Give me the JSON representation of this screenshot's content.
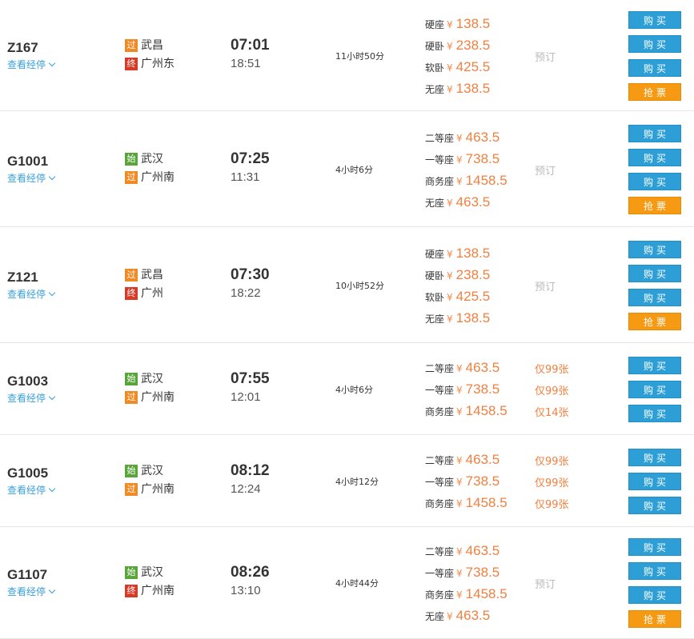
{
  "labels": {
    "via": "查看经停",
    "buy": "购买",
    "grab": "抢票",
    "book": "预订",
    "yen": "¥"
  },
  "colors": {
    "buy": "#2d9fd6",
    "grab": "#f59a12",
    "price": "#f08040",
    "link": "#3aa0d8",
    "badge_guo": "#f08a24",
    "badge_zhong": "#d83a28",
    "badge_shi": "#5aa53a"
  },
  "trains": [
    {
      "no": "Z167",
      "from": {
        "badge": "过",
        "name": "武昌"
      },
      "to": {
        "badge": "终",
        "name": "广州东"
      },
      "depart": "07:01",
      "arrive": "18:51",
      "duration": "11小时50分",
      "seats": [
        {
          "name": "硬座",
          "price": "138.5"
        },
        {
          "name": "硬卧",
          "price": "238.5"
        },
        {
          "name": "软卧",
          "price": "425.5"
        },
        {
          "name": "无座",
          "price": "138.5"
        }
      ],
      "stock": [],
      "buttons": [
        "buy",
        "buy",
        "buy",
        "grab"
      ]
    },
    {
      "no": "G1001",
      "from": {
        "badge": "始",
        "name": "武汉"
      },
      "to": {
        "badge": "过",
        "name": "广州南"
      },
      "depart": "07:25",
      "arrive": "11:31",
      "duration": "4小时6分",
      "seats": [
        {
          "name": "二等座",
          "price": "463.5"
        },
        {
          "name": "一等座",
          "price": "738.5"
        },
        {
          "name": "商务座",
          "price": "1458.5"
        },
        {
          "name": "无座",
          "price": "463.5"
        }
      ],
      "stock": [],
      "buttons": [
        "buy",
        "buy",
        "buy",
        "grab"
      ]
    },
    {
      "no": "Z121",
      "from": {
        "badge": "过",
        "name": "武昌"
      },
      "to": {
        "badge": "终",
        "name": "广州"
      },
      "depart": "07:30",
      "arrive": "18:22",
      "duration": "10小时52分",
      "seats": [
        {
          "name": "硬座",
          "price": "138.5"
        },
        {
          "name": "硬卧",
          "price": "238.5"
        },
        {
          "name": "软卧",
          "price": "425.5"
        },
        {
          "name": "无座",
          "price": "138.5"
        }
      ],
      "stock": [],
      "buttons": [
        "buy",
        "buy",
        "buy",
        "grab"
      ]
    },
    {
      "no": "G1003",
      "from": {
        "badge": "始",
        "name": "武汉"
      },
      "to": {
        "badge": "过",
        "name": "广州南"
      },
      "depart": "07:55",
      "arrive": "12:01",
      "duration": "4小时6分",
      "seats": [
        {
          "name": "二等座",
          "price": "463.5"
        },
        {
          "name": "一等座",
          "price": "738.5"
        },
        {
          "name": "商务座",
          "price": "1458.5"
        }
      ],
      "stock": [
        "仅99张",
        "仅99张",
        "仅14张"
      ],
      "buttons": [
        "buy",
        "buy",
        "buy"
      ]
    },
    {
      "no": "G1005",
      "from": {
        "badge": "始",
        "name": "武汉"
      },
      "to": {
        "badge": "过",
        "name": "广州南"
      },
      "depart": "08:12",
      "arrive": "12:24",
      "duration": "4小时12分",
      "seats": [
        {
          "name": "二等座",
          "price": "463.5"
        },
        {
          "name": "一等座",
          "price": "738.5"
        },
        {
          "name": "商务座",
          "price": "1458.5"
        }
      ],
      "stock": [
        "仅99张",
        "仅99张",
        "仅99张"
      ],
      "buttons": [
        "buy",
        "buy",
        "buy"
      ]
    },
    {
      "no": "G1107",
      "from": {
        "badge": "始",
        "name": "武汉"
      },
      "to": {
        "badge": "终",
        "name": "广州南"
      },
      "depart": "08:26",
      "arrive": "13:10",
      "duration": "4小时44分",
      "seats": [
        {
          "name": "二等座",
          "price": "463.5"
        },
        {
          "name": "一等座",
          "price": "738.5"
        },
        {
          "name": "商务座",
          "price": "1458.5"
        },
        {
          "name": "无座",
          "price": "463.5"
        }
      ],
      "stock": [],
      "buttons": [
        "buy",
        "buy",
        "buy",
        "grab"
      ]
    }
  ]
}
